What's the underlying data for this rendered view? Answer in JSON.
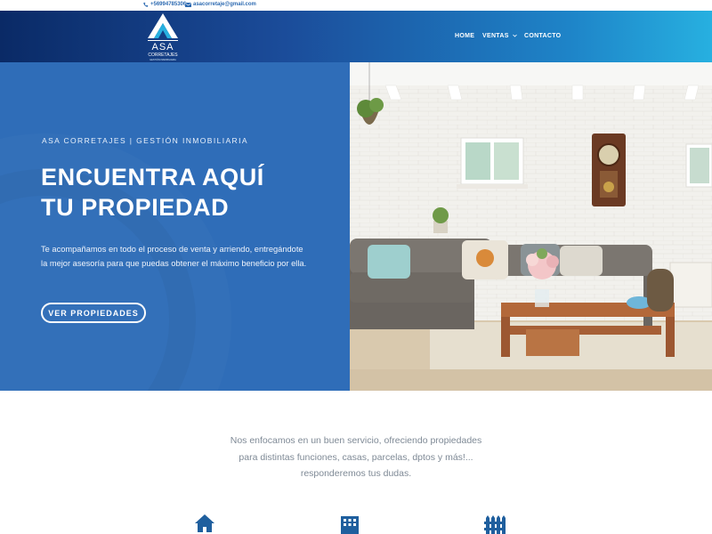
{
  "topbar": {
    "phone": "+56994785306",
    "email": "asacorretaje@gmail.com"
  },
  "logo": {
    "name": "ASA",
    "line1": "CORRETAJES",
    "line2": "GESTIÓN INMOBILIARIA"
  },
  "nav": {
    "home": "HOME",
    "ventas": "VENTAS",
    "contacto": "CONTACTO"
  },
  "hero": {
    "eyebrow": "ASA CORRETAJES | GESTIÓN INMOBILIARIA",
    "headline_line1": "ENCUENTRA AQUÍ",
    "headline_line2": "TU PROPIEDAD",
    "lead": "Te acompañamos en todo el proceso de venta y arriendo, entregándote la mejor asesoría para que puedas obtener el máximo beneficio por ella.",
    "cta": "VER PROPIEDADES"
  },
  "intro": {
    "line1": "Nos enfocamos en un buen servicio, ofreciendo propiedades",
    "line2": "para distintas funciones, casas, parcelas, dptos y más!...",
    "line3": "responderemos tus dudas."
  },
  "features": [
    {
      "icon": "house-icon"
    },
    {
      "icon": "building-icon"
    },
    {
      "icon": "fence-icon"
    }
  ],
  "colors": {
    "hero_blue": "#2f6db8",
    "header_dark": "#0a2a66",
    "header_light": "#27b0e0",
    "icon_blue": "#1f5f9e"
  }
}
